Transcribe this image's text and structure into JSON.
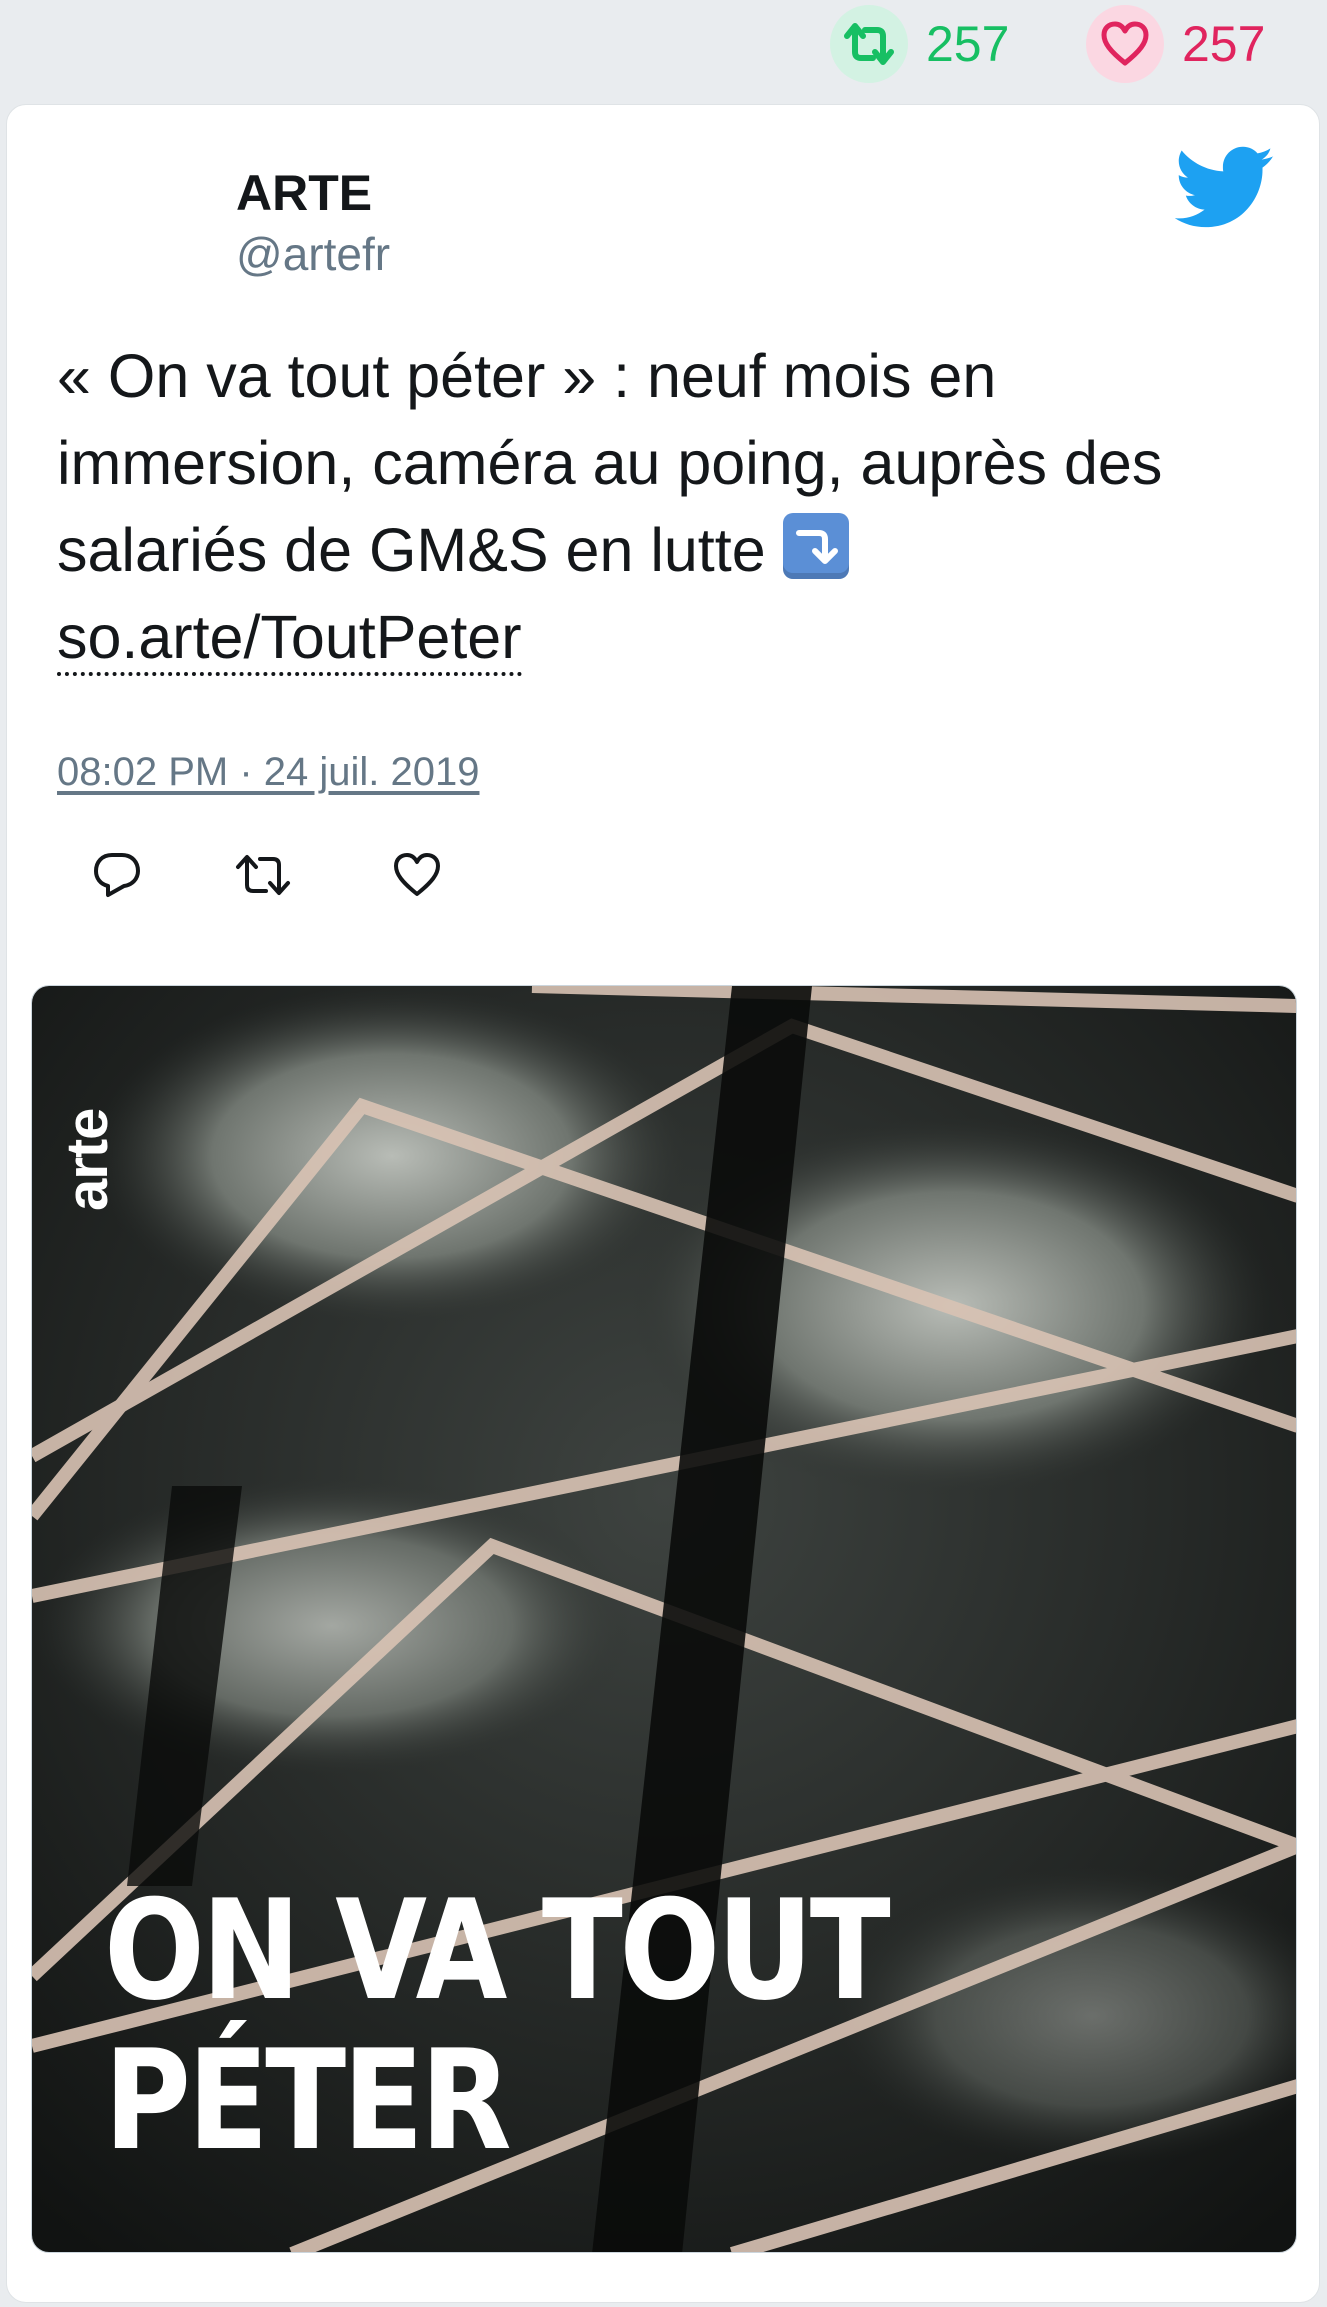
{
  "stats": {
    "retweets": "257",
    "likes": "257",
    "retweet_icon": "retweet-icon",
    "like_icon": "heart-icon",
    "retweet_color": "#17bf63",
    "like_color": "#e0245e"
  },
  "author": {
    "name": "ARTE",
    "handle": "@artefr"
  },
  "tweet": {
    "text_main": "« On va tout péter » : neuf mois en immersion, caméra au poing, auprès des salariés de GM&S en lutte ",
    "emoji": "arrow-right-hook-down-emoji",
    "link": "so.arte/ToutPeter",
    "timestamp": "08:02 PM · 24 juil. 2019"
  },
  "actions": {
    "reply_icon": "reply-icon",
    "retweet_icon": "retweet-icon",
    "like_icon": "heart-icon"
  },
  "media": {
    "logo": "arte",
    "title_line1": "ON VA TOUT",
    "title_line2": "PÉTER"
  },
  "colors": {
    "twitter_blue": "#1da1f2",
    "text": "#14171a",
    "secondary": "#657786"
  }
}
